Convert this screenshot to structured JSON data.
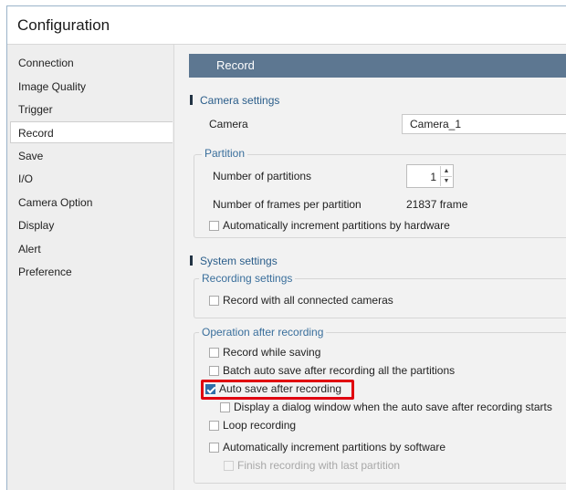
{
  "window": {
    "title": "Configuration"
  },
  "sidebar": {
    "items": [
      {
        "label": "Connection",
        "selected": false
      },
      {
        "label": "Image Quality",
        "selected": false
      },
      {
        "label": "Trigger",
        "selected": false
      },
      {
        "label": "Record",
        "selected": true
      },
      {
        "label": "Save",
        "selected": false
      },
      {
        "label": "I/O",
        "selected": false
      },
      {
        "label": "Camera Option",
        "selected": false
      },
      {
        "label": "Display",
        "selected": false
      },
      {
        "label": "Alert",
        "selected": false
      },
      {
        "label": "Preference",
        "selected": false
      }
    ]
  },
  "main": {
    "header": "Record",
    "camera_settings": {
      "title": "Camera settings",
      "camera_label": "Camera",
      "camera_value": "Camera_1",
      "partition": {
        "title": "Partition",
        "num_partitions_label": "Number of partitions",
        "num_partitions_value": "1",
        "frames_label": "Number of frames per partition",
        "frames_value": "21837 frame",
        "auto_increment_hw": {
          "label": "Automatically increment partitions by hardware",
          "checked": false
        }
      }
    },
    "system_settings": {
      "title": "System settings",
      "recording_settings": {
        "title": "Recording settings",
        "record_all": {
          "label": "Record with all connected cameras",
          "checked": false
        }
      },
      "operation_after": {
        "title": "Operation after recording",
        "record_while_saving": {
          "label": "Record while saving",
          "checked": false
        },
        "batch_auto_save": {
          "label": "Batch auto save after recording all the partitions",
          "checked": false
        },
        "auto_save": {
          "label": "Auto save after recording",
          "checked": true
        },
        "display_dialog": {
          "label": "Display a dialog window when the auto save after recording starts",
          "checked": false
        },
        "loop_recording": {
          "label": "Loop recording",
          "checked": false
        },
        "auto_increment_sw": {
          "label": "Automatically increment partitions by software",
          "checked": false
        },
        "finish_last_partition": {
          "label": "Finish recording with last partition",
          "checked": false,
          "disabled": true
        }
      }
    }
  },
  "colors": {
    "header_bg": "#5d7791",
    "accent_text": "#2a5d8a",
    "highlight_border": "#e0000f",
    "checkbox_checked": "#2f6ea8"
  }
}
